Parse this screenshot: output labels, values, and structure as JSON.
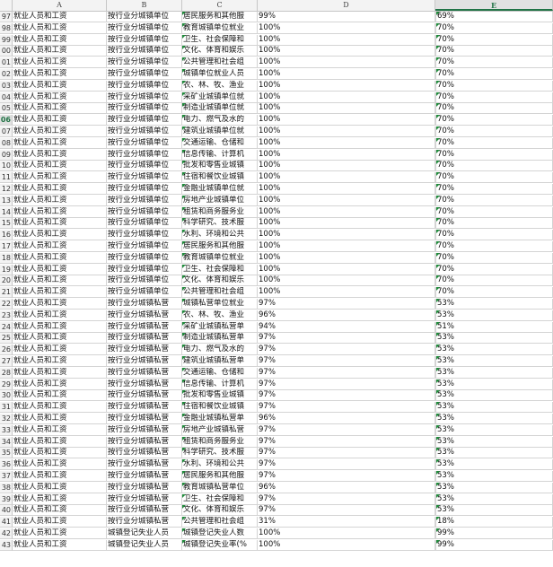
{
  "sheet": {
    "columns": [
      "A",
      "B",
      "C",
      "D",
      "E"
    ],
    "active_column": "E",
    "active_row": "06",
    "rows": [
      {
        "n": "97",
        "a": "就业人员和工资",
        "b": "按行业分城镇单位",
        "c": "居民服务和其他服",
        "d": "99%",
        "e": "69%"
      },
      {
        "n": "98",
        "a": "就业人员和工资",
        "b": "按行业分城镇单位",
        "c": "教育城镇单位就业",
        "d": "100%",
        "e": "70%"
      },
      {
        "n": "99",
        "a": "就业人员和工资",
        "b": "按行业分城镇单位",
        "c": "卫生、社会保障和",
        "d": "100%",
        "e": "70%"
      },
      {
        "n": "00",
        "a": "就业人员和工资",
        "b": "按行业分城镇单位",
        "c": "文化、体育和娱乐",
        "d": "100%",
        "e": "70%"
      },
      {
        "n": "01",
        "a": "就业人员和工资",
        "b": "按行业分城镇单位",
        "c": "公共管理和社会组",
        "d": "100%",
        "e": "70%"
      },
      {
        "n": "02",
        "a": "就业人员和工资",
        "b": "按行业分城镇单位",
        "c": "城镇单位就业人员",
        "d": "100%",
        "e": "70%"
      },
      {
        "n": "03",
        "a": "就业人员和工资",
        "b": "按行业分城镇单位",
        "c": "农、林、牧、渔业",
        "d": "100%",
        "e": "70%"
      },
      {
        "n": "04",
        "a": "就业人员和工资",
        "b": "按行业分城镇单位",
        "c": "采矿业城镇单位就",
        "d": "100%",
        "e": "70%"
      },
      {
        "n": "05",
        "a": "就业人员和工资",
        "b": "按行业分城镇单位",
        "c": "制造业城镇单位就",
        "d": "100%",
        "e": "70%"
      },
      {
        "n": "06",
        "a": "就业人员和工资",
        "b": "按行业分城镇单位",
        "c": "电力、燃气及水的",
        "d": "100%",
        "e": "70%"
      },
      {
        "n": "07",
        "a": "就业人员和工资",
        "b": "按行业分城镇单位",
        "c": "建筑业城镇单位就",
        "d": "100%",
        "e": "70%"
      },
      {
        "n": "08",
        "a": "就业人员和工资",
        "b": "按行业分城镇单位",
        "c": "交通运输、仓储和",
        "d": "100%",
        "e": "70%"
      },
      {
        "n": "09",
        "a": "就业人员和工资",
        "b": "按行业分城镇单位",
        "c": "信息传输、计算机",
        "d": "100%",
        "e": "70%"
      },
      {
        "n": "10",
        "a": "就业人员和工资",
        "b": "按行业分城镇单位",
        "c": "批发和零售业城镇",
        "d": "100%",
        "e": "70%"
      },
      {
        "n": "11",
        "a": "就业人员和工资",
        "b": "按行业分城镇单位",
        "c": "住宿和餐饮业城镇",
        "d": "100%",
        "e": "70%"
      },
      {
        "n": "12",
        "a": "就业人员和工资",
        "b": "按行业分城镇单位",
        "c": "金融业城镇单位就",
        "d": "100%",
        "e": "70%"
      },
      {
        "n": "13",
        "a": "就业人员和工资",
        "b": "按行业分城镇单位",
        "c": "房地产业城镇单位",
        "d": "100%",
        "e": "70%"
      },
      {
        "n": "14",
        "a": "就业人员和工资",
        "b": "按行业分城镇单位",
        "c": "租赁和商务服务业",
        "d": "100%",
        "e": "70%"
      },
      {
        "n": "15",
        "a": "就业人员和工资",
        "b": "按行业分城镇单位",
        "c": "科学研究、技术服",
        "d": "100%",
        "e": "70%"
      },
      {
        "n": "16",
        "a": "就业人员和工资",
        "b": "按行业分城镇单位",
        "c": "水利、环境和公共",
        "d": "100%",
        "e": "70%"
      },
      {
        "n": "17",
        "a": "就业人员和工资",
        "b": "按行业分城镇单位",
        "c": "居民服务和其他服",
        "d": "100%",
        "e": "70%"
      },
      {
        "n": "18",
        "a": "就业人员和工资",
        "b": "按行业分城镇单位",
        "c": "教育城镇单位就业",
        "d": "100%",
        "e": "70%"
      },
      {
        "n": "19",
        "a": "就业人员和工资",
        "b": "按行业分城镇单位",
        "c": "卫生、社会保障和",
        "d": "100%",
        "e": "70%"
      },
      {
        "n": "20",
        "a": "就业人员和工资",
        "b": "按行业分城镇单位",
        "c": "文化、体育和娱乐",
        "d": "100%",
        "e": "70%"
      },
      {
        "n": "21",
        "a": "就业人员和工资",
        "b": "按行业分城镇单位",
        "c": "公共管理和社会组",
        "d": "100%",
        "e": "70%"
      },
      {
        "n": "22",
        "a": "就业人员和工资",
        "b": "按行业分城镇私营",
        "c": "城镇私营单位就业",
        "d": "97%",
        "e": "53%"
      },
      {
        "n": "23",
        "a": "就业人员和工资",
        "b": "按行业分城镇私营",
        "c": "农、林、牧、渔业",
        "d": "96%",
        "e": "53%"
      },
      {
        "n": "24",
        "a": "就业人员和工资",
        "b": "按行业分城镇私营",
        "c": "采矿业城镇私营单",
        "d": "94%",
        "e": "51%"
      },
      {
        "n": "25",
        "a": "就业人员和工资",
        "b": "按行业分城镇私营",
        "c": "制造业城镇私营单",
        "d": "97%",
        "e": "53%"
      },
      {
        "n": "26",
        "a": "就业人员和工资",
        "b": "按行业分城镇私营",
        "c": "电力、燃气及水的",
        "d": "97%",
        "e": "53%"
      },
      {
        "n": "27",
        "a": "就业人员和工资",
        "b": "按行业分城镇私营",
        "c": "建筑业城镇私营单",
        "d": "97%",
        "e": "53%"
      },
      {
        "n": "28",
        "a": "就业人员和工资",
        "b": "按行业分城镇私营",
        "c": "交通运输、仓储和",
        "d": "97%",
        "e": "53%"
      },
      {
        "n": "29",
        "a": "就业人员和工资",
        "b": "按行业分城镇私营",
        "c": "信息传输、计算机",
        "d": "97%",
        "e": "53%"
      },
      {
        "n": "30",
        "a": "就业人员和工资",
        "b": "按行业分城镇私营",
        "c": "批发和零售业城镇",
        "d": "97%",
        "e": "53%"
      },
      {
        "n": "31",
        "a": "就业人员和工资",
        "b": "按行业分城镇私营",
        "c": "住宿和餐饮业城镇",
        "d": "97%",
        "e": "53%"
      },
      {
        "n": "32",
        "a": "就业人员和工资",
        "b": "按行业分城镇私营",
        "c": "金融业城镇私营单",
        "d": "96%",
        "e": "53%"
      },
      {
        "n": "33",
        "a": "就业人员和工资",
        "b": "按行业分城镇私营",
        "c": "房地产业城镇私营",
        "d": "97%",
        "e": "53%"
      },
      {
        "n": "34",
        "a": "就业人员和工资",
        "b": "按行业分城镇私营",
        "c": "租赁和商务服务业",
        "d": "97%",
        "e": "53%"
      },
      {
        "n": "35",
        "a": "就业人员和工资",
        "b": "按行业分城镇私营",
        "c": "科学研究、技术服",
        "d": "97%",
        "e": "53%"
      },
      {
        "n": "36",
        "a": "就业人员和工资",
        "b": "按行业分城镇私营",
        "c": "水利、环境和公共",
        "d": "97%",
        "e": "53%"
      },
      {
        "n": "37",
        "a": "就业人员和工资",
        "b": "按行业分城镇私营",
        "c": "居民服务和其他服",
        "d": "97%",
        "e": "53%"
      },
      {
        "n": "38",
        "a": "就业人员和工资",
        "b": "按行业分城镇私营",
        "c": "教育城镇私营单位",
        "d": "96%",
        "e": "53%"
      },
      {
        "n": "39",
        "a": "就业人员和工资",
        "b": "按行业分城镇私营",
        "c": "卫生、社会保障和",
        "d": "97%",
        "e": "53%"
      },
      {
        "n": "40",
        "a": "就业人员和工资",
        "b": "按行业分城镇私营",
        "c": "文化、体育和娱乐",
        "d": "97%",
        "e": "53%"
      },
      {
        "n": "41",
        "a": "就业人员和工资",
        "b": "按行业分城镇私营",
        "c": "公共管理和社会组",
        "d": "31%",
        "e": "18%"
      },
      {
        "n": "42",
        "a": "就业人员和工资",
        "b": "城镇登记失业人员",
        "c": "城镇登记失业人数",
        "d": "100%",
        "e": "99%"
      },
      {
        "n": "43",
        "a": "就业人员和工资",
        "b": "城镇登记失业人员",
        "c": "城镇登记失业率(%",
        "d": "100%",
        "e": "99%"
      }
    ]
  }
}
